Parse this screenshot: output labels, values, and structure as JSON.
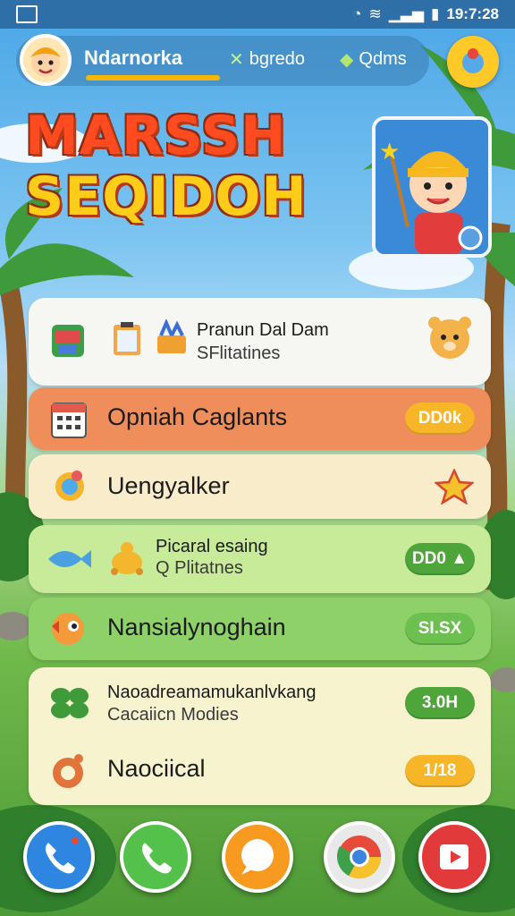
{
  "status_bar": {
    "time": "19:7:28"
  },
  "topbar": {
    "username": "Ndarnorka",
    "item1": "bgredo",
    "item2": "Qdms"
  },
  "title": {
    "line1": "MARSSH",
    "line2": "SEQIDOH"
  },
  "cards": {
    "c1": {
      "title": "Pranun Dal Dam",
      "subtitle": "SFlitatines"
    },
    "c2": {
      "title": "Opniah Caglants",
      "pill": "DD0k"
    },
    "c3": {
      "title": "Uengyalker"
    },
    "c4": {
      "title": "Picaral esaing",
      "subtitle": "Q Plitatnes",
      "pill": "DD0"
    },
    "c5": {
      "title": "Nansialynoghain",
      "pill": "SI.SX"
    },
    "c6": {
      "row1_title": "Naoadreamamukanlvkang",
      "row1_subtitle": "Cacaiicn Modies",
      "row1_pill": "3.0H",
      "row2_title": "Naociical",
      "row2_pill": "1/18"
    }
  },
  "colors": {
    "orange_pill": "#f7b628",
    "green_pill": "#4ea53a",
    "accent": "#ffcc1a"
  },
  "dock": {
    "icons": [
      "phone-icon",
      "call-icon",
      "message-icon",
      "browser-icon",
      "video-icon"
    ]
  }
}
